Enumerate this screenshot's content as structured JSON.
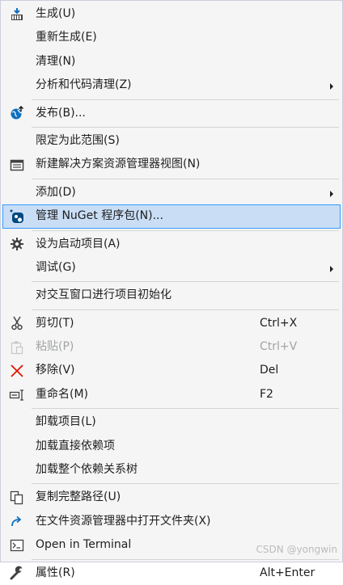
{
  "menu": {
    "items": [
      {
        "label": "生成(U)",
        "icon": "build-icon"
      },
      {
        "label": "重新生成(E)"
      },
      {
        "label": "清理(N)"
      },
      {
        "label": "分析和代码清理(Z)",
        "submenu": true
      },
      {
        "label": "发布(B)...",
        "icon": "publish-globe-icon"
      },
      {
        "label": "限定为此范围(S)"
      },
      {
        "label": "新建解决方案资源管理器视图(N)",
        "icon": "new-view-icon"
      },
      {
        "label": "添加(D)",
        "submenu": true
      },
      {
        "label": "管理 NuGet 程序包(N)...",
        "icon": "nuget-icon",
        "highlighted": true
      },
      {
        "label": "设为启动项目(A)",
        "icon": "gear-icon"
      },
      {
        "label": "调试(G)",
        "submenu": true
      },
      {
        "label": "对交互窗口进行项目初始化"
      },
      {
        "label": "剪切(T)",
        "shortcut": "Ctrl+X",
        "icon": "scissors-icon"
      },
      {
        "label": "粘贴(P)",
        "shortcut": "Ctrl+V",
        "icon": "paste-icon",
        "disabled": true
      },
      {
        "label": "移除(V)",
        "shortcut": "Del",
        "icon": "remove-x-icon"
      },
      {
        "label": "重命名(M)",
        "shortcut": "F2",
        "icon": "rename-icon"
      },
      {
        "label": "卸载项目(L)"
      },
      {
        "label": "加载直接依赖项"
      },
      {
        "label": "加载整个依赖关系树"
      },
      {
        "label": "复制完整路径(U)",
        "icon": "copy-path-icon"
      },
      {
        "label": "在文件资源管理器中打开文件夹(X)",
        "icon": "open-folder-arrow-icon"
      },
      {
        "label": "Open in Terminal",
        "icon": "terminal-icon"
      },
      {
        "label": "属性(R)",
        "shortcut": "Alt+Enter",
        "icon": "wrench-icon"
      }
    ]
  },
  "watermark": "CSDN @yongwin",
  "colors": {
    "background": "#f5f5f5",
    "highlight": "#c9def5",
    "highlight_border": "#3399ff",
    "separator": "#d4d4d4",
    "disabled_text": "#a2a4a5",
    "icon_blue": "#0e70c0",
    "icon_red": "#e51400"
  }
}
